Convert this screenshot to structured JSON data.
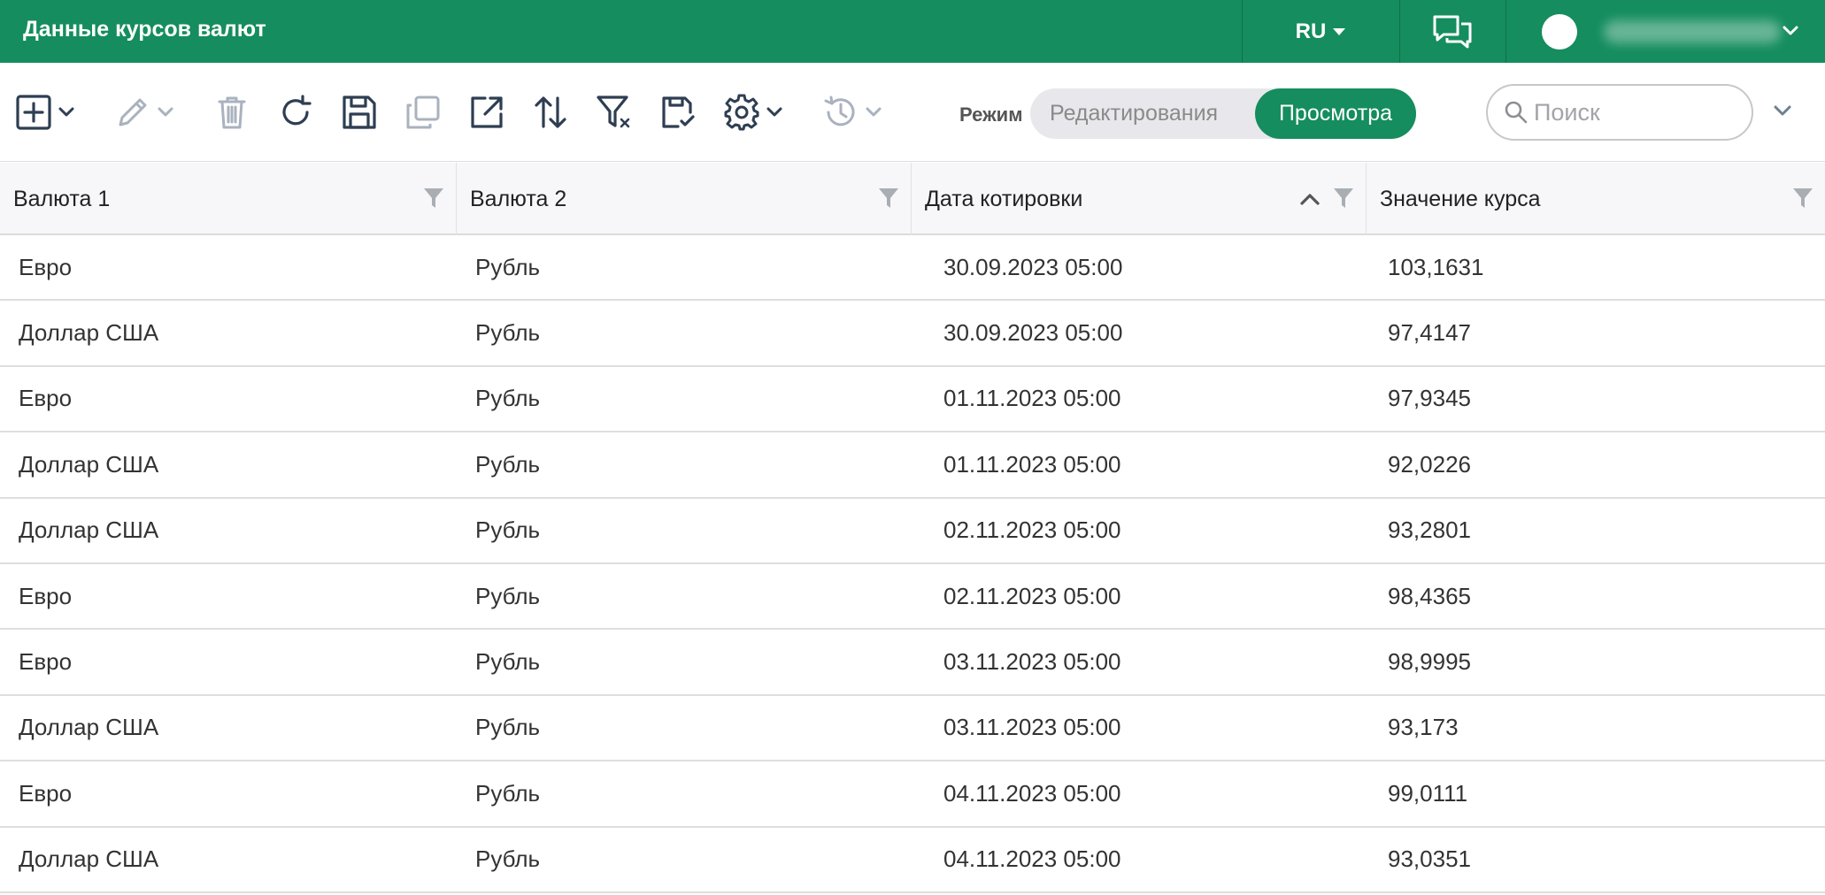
{
  "header": {
    "title": "Данные курсов валют",
    "language": "RU",
    "chat_icon": "chat-bubbles-icon",
    "user_icon": "avatar"
  },
  "toolbar": {
    "icons": [
      "add-icon",
      "edit-icon",
      "delete-icon",
      "refresh-icon",
      "save-icon",
      "copy-icon",
      "export-icon",
      "sort-icon",
      "clear-filter-icon",
      "save-filter-icon",
      "settings-icon",
      "history-icon"
    ],
    "mode_label": "Режим",
    "mode_edit": "Редактирования",
    "mode_view": "Просмотра",
    "active_mode": "Просмотра",
    "search_placeholder": "Поиск"
  },
  "colors": {
    "brand": "#158d5e",
    "icon": "#2e3e52",
    "icon_disabled": "#a9b2be"
  },
  "grid": {
    "columns": [
      "Валюта 1",
      "Валюта 2",
      "Дата котировки",
      "Значение курса"
    ],
    "sorted_column": "Дата котировки",
    "sort_direction": "asc",
    "rows": [
      [
        "Евро",
        "Рубль",
        "30.09.2023 05:00",
        "103,1631"
      ],
      [
        "Доллар США",
        "Рубль",
        "30.09.2023 05:00",
        "97,4147"
      ],
      [
        "Евро",
        "Рубль",
        "01.11.2023 05:00",
        "97,9345"
      ],
      [
        "Доллар США",
        "Рубль",
        "01.11.2023 05:00",
        "92,0226"
      ],
      [
        "Доллар США",
        "Рубль",
        "02.11.2023 05:00",
        "93,2801"
      ],
      [
        "Евро",
        "Рубль",
        "02.11.2023 05:00",
        "98,4365"
      ],
      [
        "Евро",
        "Рубль",
        "03.11.2023 05:00",
        "98,9995"
      ],
      [
        "Доллар США",
        "Рубль",
        "03.11.2023 05:00",
        "93,173"
      ],
      [
        "Евро",
        "Рубль",
        "04.11.2023 05:00",
        "99,0111"
      ],
      [
        "Доллар США",
        "Рубль",
        "04.11.2023 05:00",
        "93,0351"
      ]
    ]
  }
}
